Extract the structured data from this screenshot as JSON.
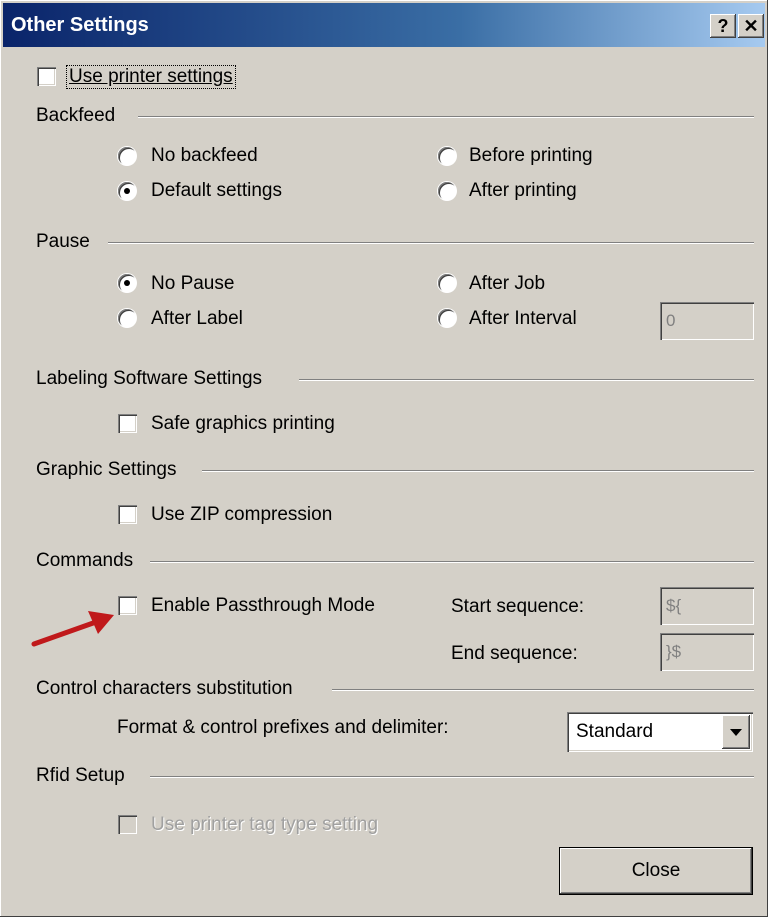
{
  "window": {
    "title": "Other Settings",
    "help_glyph": "?",
    "close_glyph": "✕"
  },
  "use_printer_settings": {
    "label": "Use printer settings",
    "checked": false
  },
  "backfeed": {
    "title": "Backfeed",
    "options": [
      "No backfeed",
      "Default settings",
      "Before printing",
      "After printing"
    ],
    "selected": "Default settings"
  },
  "pause": {
    "title": "Pause",
    "options": [
      "No Pause",
      "After Label",
      "After Job",
      "After Interval"
    ],
    "selected": "No Pause",
    "interval_value": "0"
  },
  "labeling_software": {
    "title": "Labeling Software Settings",
    "safe_graphics_label": "Safe graphics printing",
    "safe_graphics_checked": false
  },
  "graphic_settings": {
    "title": "Graphic Settings",
    "zip_label": "Use ZIP compression",
    "zip_checked": false
  },
  "commands": {
    "title": "Commands",
    "passthrough_label": "Enable Passthrough Mode",
    "passthrough_checked": false,
    "start_sequence_label": "Start sequence:",
    "start_sequence_value": "${",
    "end_sequence_label": "End sequence:",
    "end_sequence_value": "}$"
  },
  "control_chars": {
    "title": "Control characters substitution",
    "format_label": "Format & control prefixes and delimiter:",
    "format_value": "Standard"
  },
  "rfid": {
    "title": "Rfid Setup",
    "tag_type_label": "Use printer tag type setting",
    "tag_type_checked": false
  },
  "close_button": {
    "label": "Close"
  },
  "colors": {
    "title_bar_start": "#0a246a",
    "title_bar_end": "#a6caf0",
    "dialog_face": "#d4d0c8",
    "annotation_arrow": "#c0191b"
  }
}
